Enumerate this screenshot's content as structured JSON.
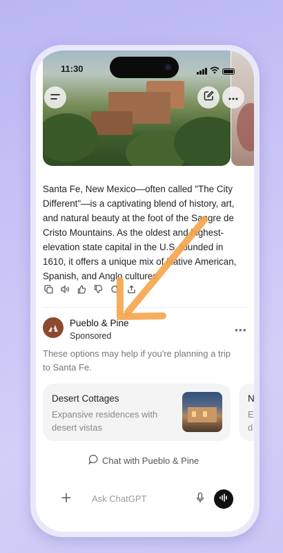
{
  "status_bar": {
    "time": "11:30"
  },
  "message": {
    "text": "Santa Fe, New Mexico—often called \"The City Different\"—is a captivating blend of history, art, and natural beauty at the foot of the Sangre de Cristo Mountains. As the oldest and highest-elevation state capital in the U.S. founded in 1610, it offers a unique mix of Native American, Spanish, and Anglo cultures."
  },
  "ad": {
    "brand_name": "Pueblo & Pine",
    "sponsored_label": "Sponsored",
    "help_text": "These options may help if you're planning a trip to Santa Fe.",
    "cards": [
      {
        "title": "Desert Cottages",
        "description": "Expansive residences with desert vistas"
      },
      {
        "title": "N",
        "description": "E… d…"
      }
    ],
    "chat_link": "Chat with Pueblo & Pine"
  },
  "composer": {
    "placeholder": "Ask ChatGPT"
  },
  "icons": {
    "menu": "menu-icon",
    "edit": "edit-icon",
    "more": "more-icon",
    "copy": "copy-icon",
    "speaker": "speaker-icon",
    "like": "thumbs-up-icon",
    "dislike": "thumbs-down-icon",
    "regenerate": "refresh-icon",
    "share": "share-icon",
    "chat": "chat-bubble-icon",
    "plus": "plus-icon",
    "mic": "mic-icon",
    "voice": "voice-mode-icon"
  },
  "colors": {
    "arrow": "#f5a54a",
    "background": "#c6c3f6",
    "brand_logo": "#8b4a2f"
  }
}
